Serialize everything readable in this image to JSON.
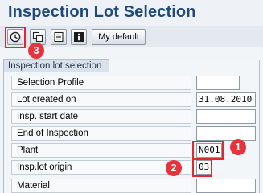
{
  "page": {
    "title": "Inspection Lot Selection"
  },
  "toolbar": {
    "execute_icon": "execute-clock-icon",
    "copy_icon": "copy-screens-icon",
    "variant_icon": "variant-list-icon",
    "info_icon": "info-icon",
    "my_default_label": "My default"
  },
  "section": {
    "title": "Inspection lot selection"
  },
  "fields": [
    {
      "label": "Selection Profile",
      "value": ""
    },
    {
      "label": "Lot created on",
      "value": "31.08.2010"
    },
    {
      "label": "Insp. start date",
      "value": ""
    },
    {
      "label": "End of Inspection",
      "value": ""
    },
    {
      "label": "Plant",
      "value": "N001"
    },
    {
      "label": "Insp.lot origin",
      "value": "03"
    },
    {
      "label": "Material",
      "value": ""
    }
  ],
  "callouts": [
    "1",
    "2",
    "3"
  ],
  "colors": {
    "title": "#1f4a7a",
    "callout": "#e0282f"
  }
}
